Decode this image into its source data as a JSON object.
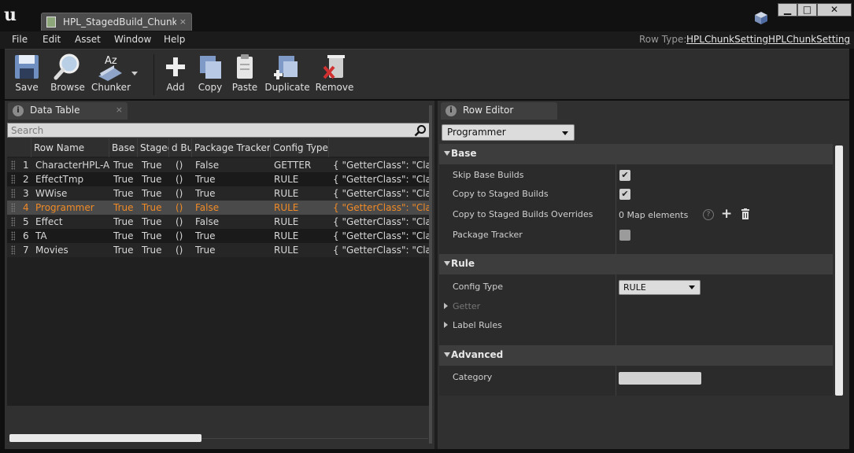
{
  "window": {
    "tab_title": "HPL_StagedBuild_Chunks",
    "tab_close": "×",
    "minimize": "▁",
    "maximize": "□",
    "close": "✕"
  },
  "menu": {
    "items": [
      "File",
      "Edit",
      "Asset",
      "Window",
      "Help"
    ],
    "row_type_label": "Row Type:",
    "row_type_value": "HPLChunkSettingHPLChunkSetting"
  },
  "toolbar": {
    "save": "Save",
    "browse": "Browse",
    "chunker": "Chunker",
    "add": "Add",
    "copy": "Copy",
    "paste": "Paste",
    "duplicate": "Duplicate",
    "remove": "Remove"
  },
  "data_table": {
    "tab_label": "Data Table",
    "tab_close": "×",
    "search_placeholder": "Search",
    "columns": [
      "Row Name",
      "Base E",
      "Stagec",
      "d Bu",
      "Package Tracker",
      "Config Type"
    ],
    "rows": [
      {
        "num": "1",
        "name": "CharacterHPL-A",
        "base": "True",
        "staged": "True",
        "overrides": "()",
        "tracker": "False",
        "config": "GETTER",
        "getter": "{ \"GetterClass\": \"Class\"",
        "selected": false
      },
      {
        "num": "2",
        "name": "EffectTmp",
        "base": "True",
        "staged": "True",
        "overrides": "()",
        "tracker": "True",
        "config": "RULE",
        "getter": "{ \"GetterClass\": \"Class\"",
        "selected": false
      },
      {
        "num": "3",
        "name": "WWise",
        "base": "True",
        "staged": "True",
        "overrides": "()",
        "tracker": "True",
        "config": "RULE",
        "getter": "{ \"GetterClass\": \"Class\"",
        "selected": false
      },
      {
        "num": "4",
        "name": "Programmer",
        "base": "True",
        "staged": "True",
        "overrides": "()",
        "tracker": "False",
        "config": "RULE",
        "getter": "{ \"GetterClass\": \"Class\"",
        "selected": true
      },
      {
        "num": "5",
        "name": "Effect",
        "base": "True",
        "staged": "True",
        "overrides": "()",
        "tracker": "False",
        "config": "RULE",
        "getter": "{ \"GetterClass\": \"Class\"",
        "selected": false
      },
      {
        "num": "6",
        "name": "TA",
        "base": "True",
        "staged": "True",
        "overrides": "()",
        "tracker": "True",
        "config": "RULE",
        "getter": "{ \"GetterClass\": \"Class\"",
        "selected": false
      },
      {
        "num": "7",
        "name": "Movies",
        "base": "True",
        "staged": "True",
        "overrides": "()",
        "tracker": "True",
        "config": "RULE",
        "getter": "{ \"GetterClass\": \"Class\"",
        "selected": false
      }
    ]
  },
  "row_editor": {
    "tab_label": "Row Editor",
    "selected_row": "Programmer",
    "base": {
      "label": "Base",
      "skip_base_builds": "Skip Base Builds",
      "skip_base_builds_checked": true,
      "copy_to_staged": "Copy to Staged Builds",
      "copy_to_staged_checked": true,
      "overrides": "Copy to Staged Builds Overrides",
      "overrides_value": "0 Map elements",
      "package_tracker": "Package Tracker",
      "package_tracker_checked": false
    },
    "rule": {
      "label": "Rule",
      "config_type": "Config Type",
      "config_type_value": "RULE",
      "getter": "Getter",
      "label_rules": "Label Rules"
    },
    "advanced": {
      "label": "Advanced",
      "category": "Category",
      "category_value": ""
    }
  },
  "colors": {
    "selected_row_text": "#f08a26",
    "panel_bg": "#303030",
    "title_bg": "#111111"
  }
}
